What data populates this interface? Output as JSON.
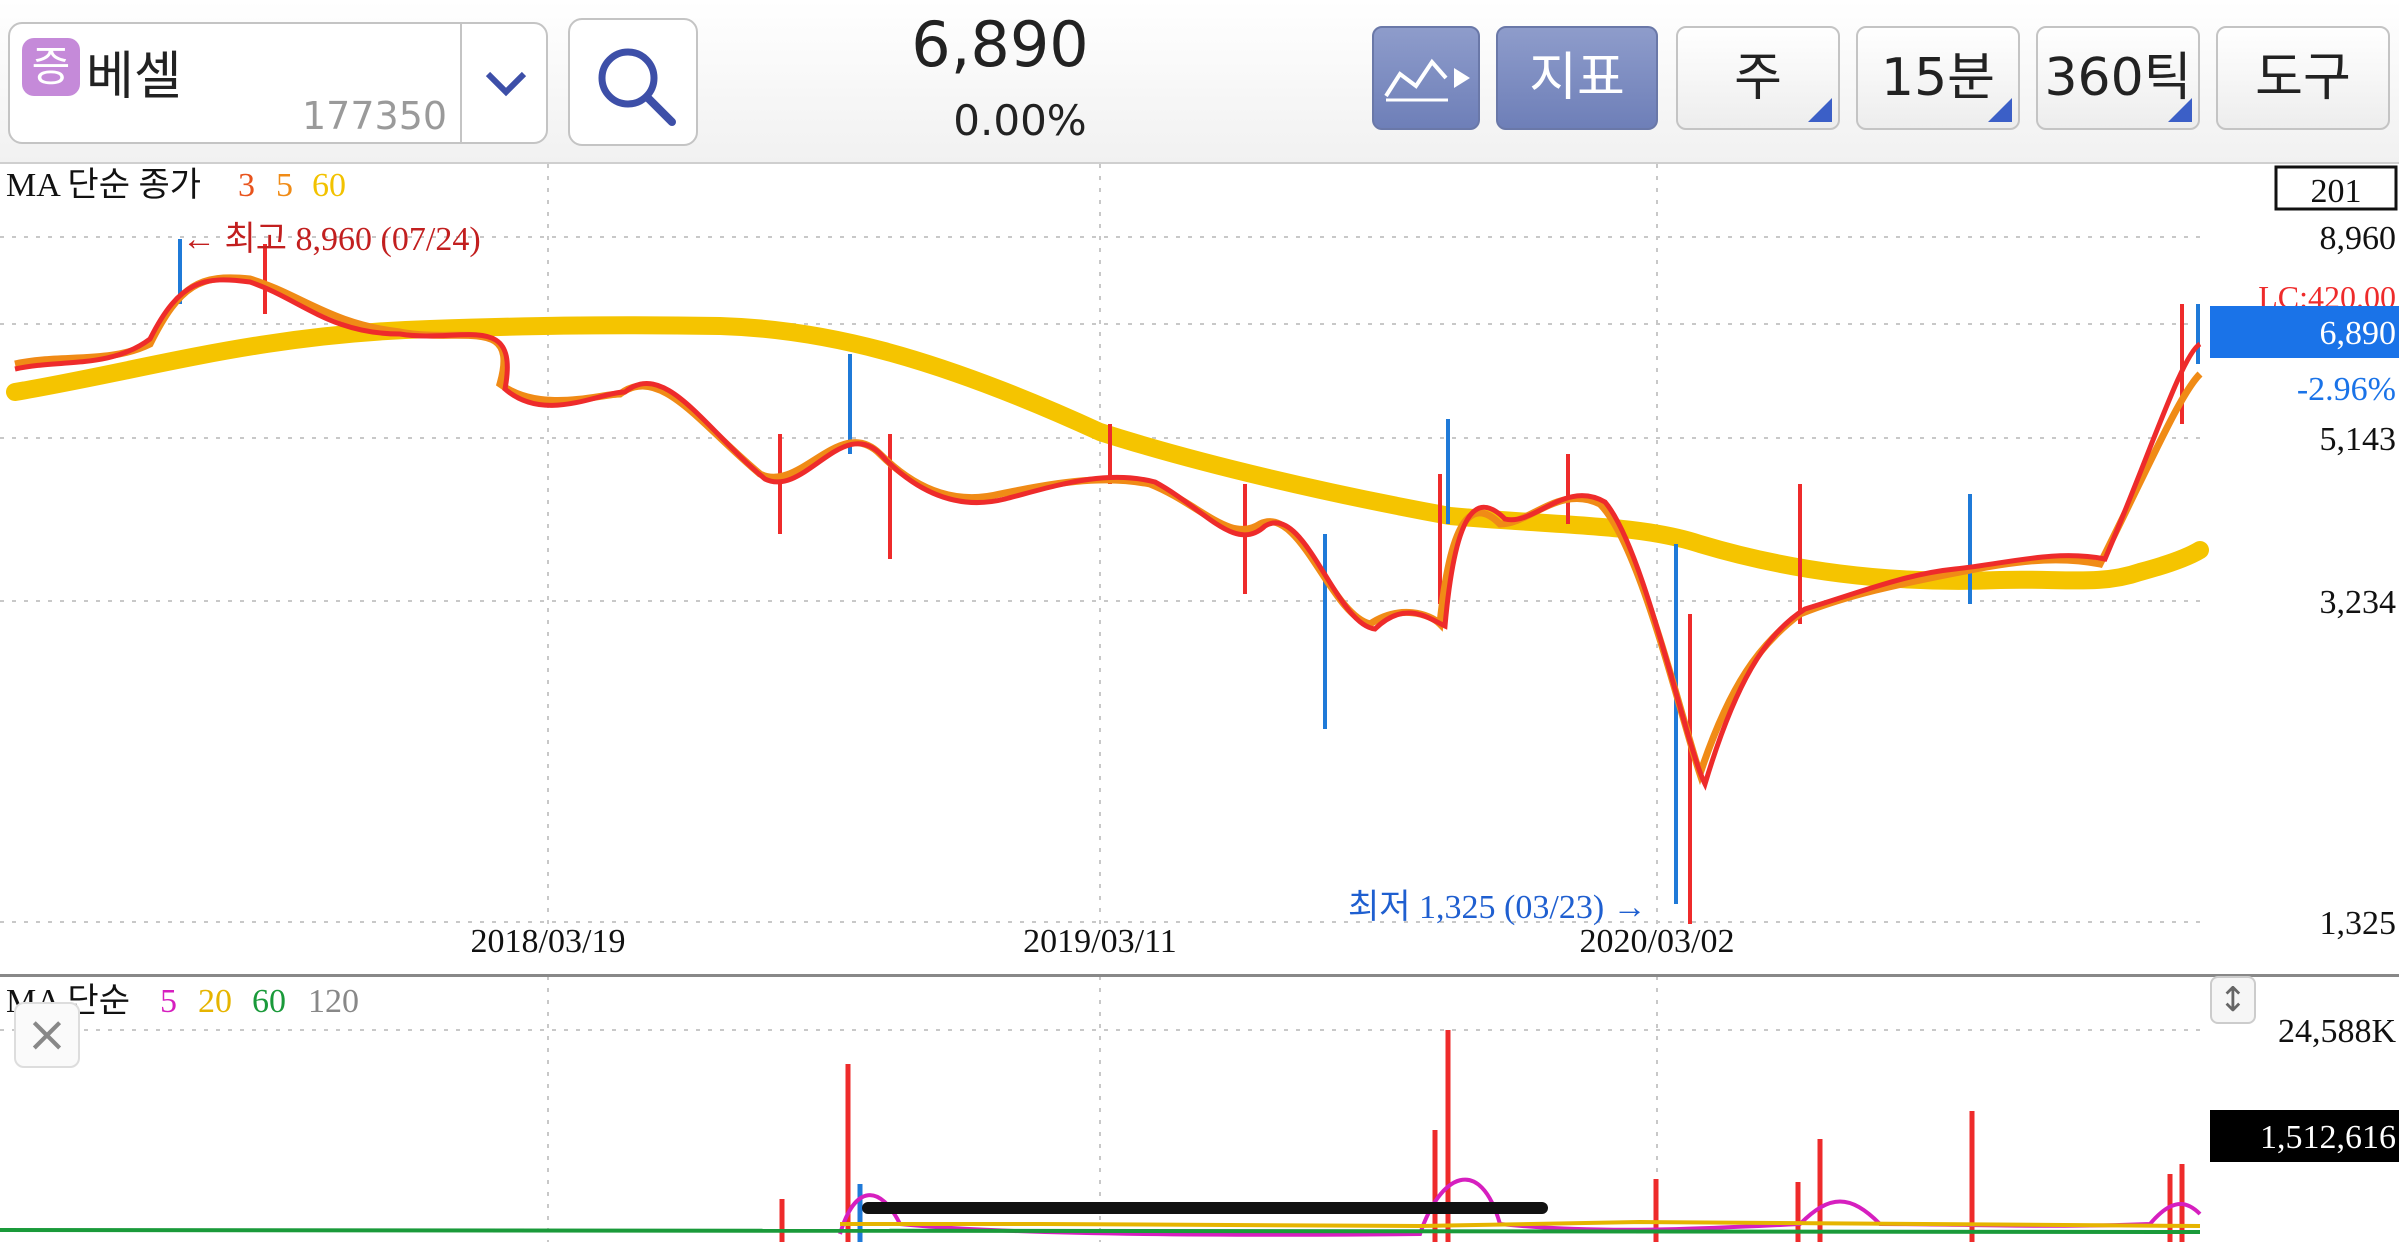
{
  "toolbar": {
    "badge": "증",
    "stock_name": "베셀",
    "stock_code": "177350",
    "price": "6,890",
    "change_rate": "0.00%",
    "indicator_label": "지표",
    "period_label": "주",
    "minute_label": "15분",
    "tick_label": "360틱",
    "tools_label": "도구"
  },
  "price_chart": {
    "legend_prefix": "MA 단순 종가",
    "ma_periods": [
      "3",
      "5",
      "60"
    ],
    "ma_colors": [
      "#e8531c",
      "#f08b16",
      "#f2c200"
    ],
    "high_annotation": "← 최고 8,960 (07/24)",
    "low_annotation": "최저 1,325 (03/23) →",
    "count_box": "201",
    "y_labels": [
      "8,960",
      "5,143",
      "3,234",
      "1,325"
    ],
    "lc_label": "LC:420.00",
    "current_price_tag": "6,890",
    "current_change": "-2.96%",
    "x_labels": [
      "2018/03/19",
      "2019/03/11",
      "2020/03/02"
    ],
    "up_color": "#ee2b2b",
    "down_color": "#1f7ad8",
    "tag_color": "#1a73e8"
  },
  "volume_chart": {
    "legend_prefix": "MA 단순",
    "ma_periods": [
      "5",
      "20",
      "60",
      "120"
    ],
    "ma_colors": [
      "#d61fbf",
      "#e6b400",
      "#1a9a3a",
      "#888888"
    ],
    "max_label": "24,588K",
    "current_volume": "1,512,616"
  },
  "chart_data": {
    "type": "line",
    "x_ticks": [
      "2018/03/19",
      "2019/03/11",
      "2020/03/02"
    ],
    "y_ticks": [
      8960,
      5143,
      3234,
      1325
    ],
    "high": {
      "value": 8960,
      "date": "07/24"
    },
    "low": {
      "value": 1325,
      "date": "03/23"
    },
    "series": [
      {
        "name": "60",
        "values": [
          5600,
          5900,
          6200,
          6500,
          6550,
          6520,
          6430,
          6300,
          6000,
          5650,
          5300,
          4950,
          4650,
          4400,
          4200,
          4000,
          3800,
          3500,
          3300,
          3250,
          3280,
          3300
        ]
      },
      {
        "name": "3",
        "values": [
          6300,
          7000,
          8200,
          7400,
          6800,
          6600,
          6000,
          5800,
          5100,
          4700,
          4350,
          4700,
          4600,
          4500,
          3700,
          3900,
          4200,
          4100,
          3100,
          3400,
          3550,
          6890
        ]
      }
    ]
  }
}
